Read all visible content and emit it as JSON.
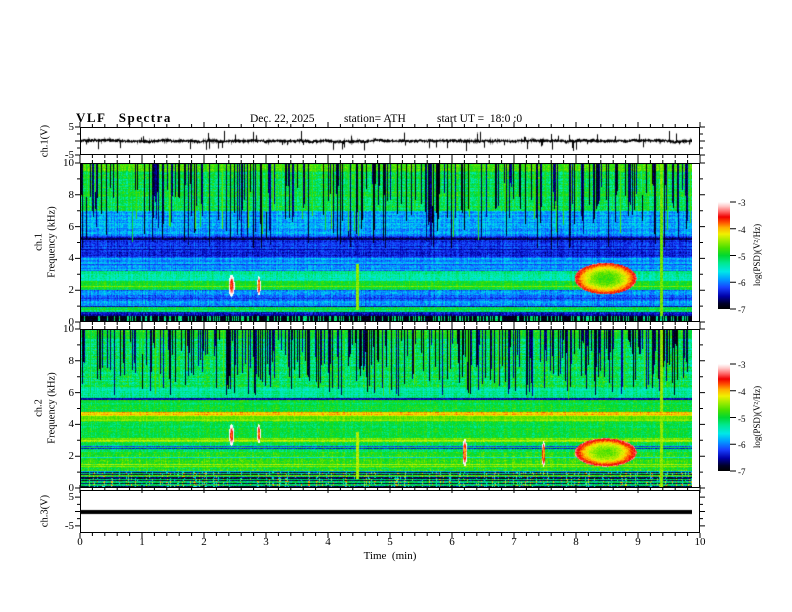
{
  "header": {
    "title": "VLF Spectra",
    "date": "Dec. 22, 2025",
    "station": "station= ATH",
    "start_ut": "start UT =  18:0 :0"
  },
  "x_axis": {
    "label": "Time  (min)",
    "min": 0,
    "max": 10,
    "minor_step": 0.2,
    "tick_labels": [
      "0",
      "1",
      "2",
      "3",
      "4",
      "5",
      "6",
      "7",
      "8",
      "9",
      "10"
    ],
    "data_end_min": 9.85
  },
  "colorbar": {
    "label": "log(PSD)(V²/Hz)",
    "min": -7,
    "max": -3,
    "tick_labels": [
      "-3",
      "-4",
      "-5",
      "-6",
      "-7"
    ],
    "stops": [
      [
        0,
        "#000000"
      ],
      [
        0.05,
        "#000028"
      ],
      [
        0.12,
        "#0000a8"
      ],
      [
        0.2,
        "#1840ff"
      ],
      [
        0.28,
        "#00a0ff"
      ],
      [
        0.35,
        "#00e8e8"
      ],
      [
        0.43,
        "#00e890"
      ],
      [
        0.5,
        "#00d830"
      ],
      [
        0.57,
        "#48e000"
      ],
      [
        0.64,
        "#a0ec00"
      ],
      [
        0.7,
        "#f0f000"
      ],
      [
        0.76,
        "#ffb000"
      ],
      [
        0.81,
        "#ff5000"
      ],
      [
        0.86,
        "#f00000"
      ],
      [
        0.91,
        "#ff6868"
      ],
      [
        0.96,
        "#ffc8c8"
      ],
      [
        1,
        "#ffffff"
      ]
    ]
  },
  "chart_data": [
    {
      "id": "ch1_wave",
      "type": "line",
      "ylabel": "ch.1(V)",
      "ylim": [
        -5,
        5
      ],
      "ytick_labels": [
        "5",
        "-5"
      ],
      "baseline": 0,
      "noise_amp": 0.5,
      "spike_rate": 0.09,
      "spike_amp": [
        1.2,
        3.9
      ],
      "seed": 303
    },
    {
      "id": "ch1_spec",
      "type": "heatmap",
      "ylabel_ch": "ch.1",
      "ylabel_freq": "Frequency  (kHz)",
      "ylim": [
        0,
        10
      ],
      "ytick_labels": [
        "10",
        "8",
        "6",
        "4",
        "2",
        "0"
      ],
      "clim": [
        -7,
        -3
      ],
      "t_end": 9.85,
      "seed": 101,
      "bands": [
        {
          "f0": 9.55,
          "f1": 10,
          "lv": -4.75,
          "vr": 0.3
        },
        {
          "f0": 7.0,
          "f1": 9.55,
          "lv": -5.05,
          "vr": 0.4
        },
        {
          "f0": 5.4,
          "f1": 7.0,
          "lv": -5.85,
          "vr": 0.35
        },
        {
          "f0": 4.0,
          "f1": 5.4,
          "lv": -6.3,
          "vr": 0.3
        },
        {
          "f0": 3.2,
          "f1": 4.0,
          "lv": -5.9,
          "vr": 0.3
        },
        {
          "f0": 2.55,
          "f1": 3.2,
          "lv": -5.35,
          "vr": 0.3
        },
        {
          "f0": 1.95,
          "f1": 2.55,
          "lv": -4.95,
          "vr": 0.3
        },
        {
          "f0": 0.95,
          "f1": 1.95,
          "lv": -6.0,
          "vr": 0.35
        },
        {
          "f0": 0.55,
          "f1": 0.95,
          "lv": -5.2,
          "vr": 0.3
        },
        {
          "f0": 0.32,
          "f1": 0.55,
          "lv": -6.5,
          "vr": 0.3
        },
        {
          "f0": 0,
          "f1": 0.32,
          "lv": -6.9,
          "vr": 0.1,
          "dash": true
        }
      ],
      "hlines": [
        {
          "f": 5.2,
          "lv": -6.7,
          "th": 0.14
        },
        {
          "f": 4.55,
          "lv": -6.5
        },
        {
          "f": 3.62,
          "lv": -6.2
        },
        {
          "f": 2.2,
          "lv": -4.55
        },
        {
          "f": 1.45,
          "lv": -6.3
        },
        {
          "f": 0.9,
          "lv": -6.5
        },
        {
          "f": 0.72,
          "lv": -4.9
        }
      ],
      "dark_stripes": {
        "density": 0.33,
        "fmin": 4.6,
        "frange": 4.2
      },
      "bright_stripes": {
        "density": 0.09,
        "fmin": 5.0,
        "frange": 3.5,
        "level": -4.8
      },
      "vlines": [
        {
          "t": 4.45,
          "f0": 0.7,
          "f1": 3.6,
          "level": -4.5
        },
        {
          "t": 9.35,
          "f0": 0.3,
          "f1": 10,
          "level": -4.6
        }
      ],
      "blobs": [
        {
          "t": 2.42,
          "f": 2.25,
          "rt": 0.05,
          "rf": 0.7,
          "level": -3.8
        },
        {
          "t": 2.86,
          "f": 2.25,
          "rt": 0.03,
          "rf": 0.6,
          "level": -4.0
        },
        {
          "t": 8.45,
          "f": 2.7,
          "rt": 0.5,
          "rf": 1.0,
          "level": -4.8
        }
      ]
    },
    {
      "id": "ch2_spec",
      "type": "heatmap",
      "ylabel_ch": "ch.2",
      "ylabel_freq": "Frequency  (kHz)",
      "ylim": [
        0,
        10
      ],
      "ytick_labels": [
        "10",
        "8",
        "6",
        "4",
        "2",
        "0"
      ],
      "clim": [
        -7,
        -3
      ],
      "t_end": 9.85,
      "seed": 202,
      "bands": [
        {
          "f0": 9.4,
          "f1": 10,
          "lv": -4.9,
          "vr": 0.3
        },
        {
          "f0": 6.4,
          "f1": 9.4,
          "lv": -5.15,
          "vr": 0.45
        },
        {
          "f0": 5.7,
          "f1": 6.4,
          "lv": -5.35,
          "vr": 0.3
        },
        {
          "f0": 4.75,
          "f1": 5.7,
          "lv": -5.05,
          "vr": 0.3
        },
        {
          "f0": 4.55,
          "f1": 4.75,
          "lv": -4.05,
          "vr": 0.25
        },
        {
          "f0": 4.2,
          "f1": 4.55,
          "lv": -4.55,
          "vr": 0.2
        },
        {
          "f0": 3.15,
          "f1": 4.2,
          "lv": -5.0,
          "vr": 0.3
        },
        {
          "f0": 2.85,
          "f1": 3.15,
          "lv": -4.6,
          "vr": 0.25
        },
        {
          "f0": 2.25,
          "f1": 2.85,
          "lv": -5.05,
          "vr": 0.3
        },
        {
          "f0": 1.05,
          "f1": 2.25,
          "lv": -4.9,
          "vr": 0.35
        },
        {
          "f0": 0,
          "f1": 1.05,
          "lv": -5.3,
          "vr": 0.3,
          "stripes": true
        }
      ],
      "hlines": [
        {
          "f": 5.6,
          "lv": -6.5,
          "th": 0.12
        },
        {
          "f": 2.95,
          "lv": -4.35
        },
        {
          "f": 2.6,
          "lv": -6.2
        },
        {
          "f": 2.45,
          "lv": -6.4
        },
        {
          "f": 1.9,
          "lv": -5.6
        },
        {
          "f": 1.45,
          "lv": -4.4
        },
        {
          "f": 1.3,
          "lv": -4.5
        },
        {
          "f": 1.0,
          "lv": -5.8
        },
        {
          "f": 0.75,
          "lv": -4.6
        }
      ],
      "dark_stripes": {
        "density": 0.42,
        "fmin": 5.8,
        "frange": 3.6
      },
      "bright_stripes": {
        "density": 0.07,
        "fmin": 5.5,
        "frange": 3.0,
        "level": -4.8
      },
      "vlines": [
        {
          "t": 4.45,
          "f0": 0.5,
          "f1": 3.5,
          "level": -4.4
        },
        {
          "t": 9.35,
          "f0": 0,
          "f1": 10,
          "level": -4.5
        }
      ],
      "blobs": [
        {
          "t": 2.42,
          "f": 3.3,
          "rt": 0.04,
          "rf": 0.7,
          "level": -3.8
        },
        {
          "t": 2.86,
          "f": 3.4,
          "rt": 0.03,
          "rf": 0.6,
          "level": -3.9
        },
        {
          "t": 6.18,
          "f": 2.2,
          "rt": 0.035,
          "rf": 0.9,
          "level": -4.0
        },
        {
          "t": 7.45,
          "f": 2.1,
          "rt": 0.03,
          "rf": 0.8,
          "level": -4.1
        },
        {
          "t": 8.45,
          "f": 2.2,
          "rt": 0.5,
          "rf": 0.9,
          "level": -4.7
        }
      ]
    },
    {
      "id": "ch3_wave",
      "type": "line",
      "ylabel": "ch.3(V)",
      "ylim": [
        -7.5,
        7.5
      ],
      "ytick_labels": [
        "5",
        "-5"
      ],
      "constant": 0,
      "line_thickness_px": 4
    }
  ]
}
